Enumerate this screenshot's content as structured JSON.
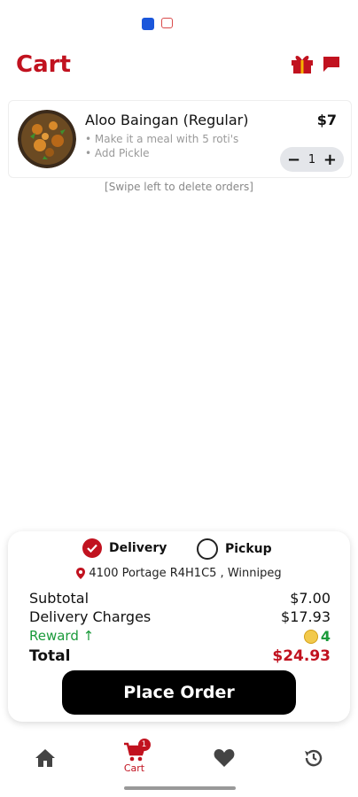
{
  "header": {
    "title": "Cart"
  },
  "cart": {
    "items": [
      {
        "name": "Aloo Baingan (Regular)",
        "price": "$7",
        "options": [
          "• Make it a meal with 5 roti's",
          "• Add Pickle"
        ],
        "quantity": "1"
      }
    ],
    "swipe_hint": "[Swipe left to delete orders]"
  },
  "order": {
    "delivery_label": "Delivery",
    "pickup_label": "Pickup",
    "selected": "Delivery",
    "address": "4100 Portage R4H1C5 , Winnipeg",
    "subtotal_label": "Subtotal",
    "subtotal_value": "$7.00",
    "delivery_label_row": "Delivery Charges",
    "delivery_value": "$17.93",
    "reward_label": "Reward ↑",
    "reward_value": "4",
    "total_label": "Total",
    "total_value": "$24.93",
    "place_order_label": "Place Order"
  },
  "nav": {
    "cart_label": "Cart",
    "cart_badge": "1"
  },
  "colors": {
    "accent": "#c1121f",
    "reward": "#1a9a3a"
  }
}
